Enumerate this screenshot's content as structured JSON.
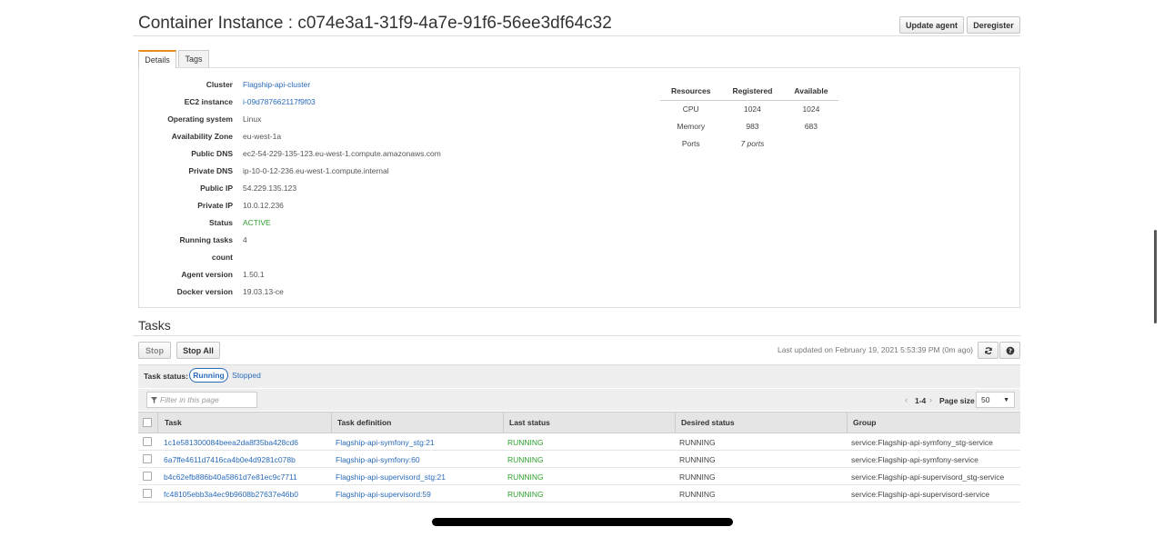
{
  "header": {
    "title": "Container Instance : c074e3a1-31f9-4a7e-91f6-56ee3df64c32",
    "update_agent": "Update agent",
    "deregister": "Deregister"
  },
  "tabs": [
    "Details",
    "Tags"
  ],
  "details": [
    {
      "label": "Cluster",
      "value": "Flagship-api-cluster",
      "kind": "link"
    },
    {
      "label": "EC2 instance",
      "value": "i-09d787662117f9f03",
      "kind": "link"
    },
    {
      "label": "Operating system",
      "value": "Linux",
      "kind": "text"
    },
    {
      "label": "Availability Zone",
      "value": "eu-west-1a",
      "kind": "text"
    },
    {
      "label": "Public DNS",
      "value": "ec2-54-229-135-123.eu-west-1.compute.amazonaws.com",
      "kind": "text"
    },
    {
      "label": "Private DNS",
      "value": "ip-10-0-12-236.eu-west-1.compute.internal",
      "kind": "text"
    },
    {
      "label": "Public IP",
      "value": "54.229.135.123",
      "kind": "text"
    },
    {
      "label": "Private IP",
      "value": "10.0.12.236",
      "kind": "text"
    },
    {
      "label": "Status",
      "value": "ACTIVE",
      "kind": "status"
    },
    {
      "label": "Running tasks",
      "value": "4",
      "kind": "text"
    },
    {
      "label": "count",
      "value": "",
      "kind": "text"
    },
    {
      "label": "Agent version",
      "value": "1.50.1",
      "kind": "text"
    },
    {
      "label": "Docker version",
      "value": "19.03.13-ce",
      "kind": "text"
    }
  ],
  "resources": {
    "headers": [
      "Resources",
      "Registered",
      "Available"
    ],
    "rows": [
      [
        "CPU",
        "1024",
        "1024"
      ],
      [
        "Memory",
        "983",
        "683"
      ],
      [
        "Ports",
        "7 ports",
        ""
      ]
    ]
  },
  "tasks": {
    "title": "Tasks",
    "stop": "Stop",
    "stop_all": "Stop All",
    "last_updated": "Last updated on February 19, 2021 5:53:39 PM (0m ago)",
    "task_status_label": "Task status:",
    "status_running": "Running",
    "status_stopped": "Stopped",
    "filter_placeholder": "Filter in this page",
    "pagination": "1-4",
    "page_size_label": "Page size",
    "page_size": "50",
    "columns": [
      "Task",
      "Task definition",
      "Last status",
      "Desired status",
      "Group"
    ],
    "rows": [
      [
        "1c1e581300084beea2da8f35ba428cd6",
        "Flagship-api-symfony_stg:21",
        "RUNNING",
        "RUNNING",
        "service:Flagship-api-symfony_stg-service"
      ],
      [
        "6a7ffe4611d7416ca4b0e4d9281c078b",
        "Flagship-api-symfony:60",
        "RUNNING",
        "RUNNING",
        "service:Flagship-api-symfony-service"
      ],
      [
        "b4c62efb886b40a5861d7e81ec9c7711",
        "Flagship-api-supervisord_stg:21",
        "RUNNING",
        "RUNNING",
        "service:Flagship-api-supervisord_stg-service"
      ],
      [
        "fc48105ebb3a4ec9b9608b27637e46b0",
        "Flagship-api-supervisord:59",
        "RUNNING",
        "RUNNING",
        "service:Flagship-api-supervisord-service"
      ]
    ]
  },
  "icons": {
    "refresh": "refresh-icon",
    "help": "help-icon",
    "filter": "filter-icon"
  },
  "colors": {
    "link": "#2a6bb8",
    "running": "#2ea02e",
    "tab_accent": "#e88c1e"
  }
}
